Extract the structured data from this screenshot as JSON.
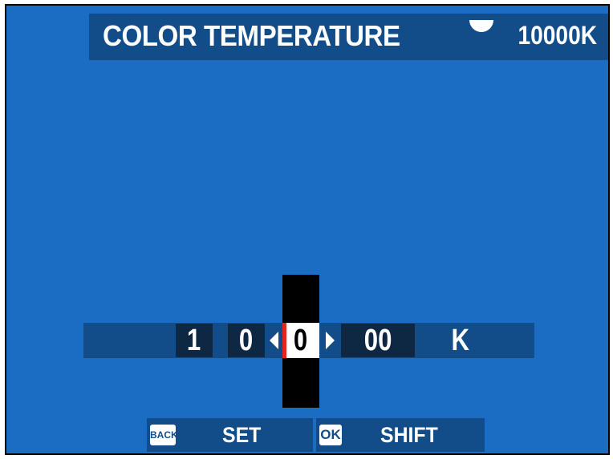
{
  "header": {
    "title": "COLOR TEMPERATURE",
    "icon": "white-balance-icon",
    "value": "10000K"
  },
  "editor": {
    "digits": [
      "1",
      "0",
      "0",
      "00"
    ],
    "selected_index": 2,
    "unit": "K",
    "accent_color": "#e3261e"
  },
  "footer": {
    "back_badge": "BACK",
    "set_label": "SET",
    "ok_badge": "OK",
    "shift_label": "SHIFT"
  }
}
